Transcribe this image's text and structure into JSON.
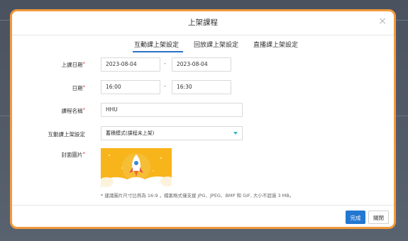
{
  "modal": {
    "title": "上架課程",
    "close_glyph": "×"
  },
  "tabs": [
    {
      "label": "互動課上架設定",
      "active": true
    },
    {
      "label": "回放課上架設定",
      "active": false
    },
    {
      "label": "直播課上架設定",
      "active": false
    }
  ],
  "form": {
    "date_label": "上課日期",
    "date_start": "2023-08-04",
    "date_end": "2023-08-04",
    "time_label": "日期",
    "time_start": "16:00",
    "time_end": "16:30",
    "name_label": "課程名稱",
    "name_value": "HHU",
    "setting_label": "互動課上架設定",
    "setting_value": "蓄積模式(課程未上架)",
    "cover_label": "封面圖片",
    "required_mark": "*",
    "range_separator": "-",
    "hint": "* 建議圖片尺寸比例為 16:9 ，檔案格式僅支援 JPG、JPEG、BMP 和 GIF, 大小不超過 3 MB。"
  },
  "footer": {
    "confirm_label": "完成",
    "close_label": "關閉"
  },
  "colors": {
    "accent": "#2377d1",
    "modal_border": "#f29a3c",
    "cover_yellow": "#f8b41b"
  },
  "icons": {
    "cover": "rocket-icon",
    "select_caret": "chevron-down-icon",
    "close": "close-icon"
  }
}
